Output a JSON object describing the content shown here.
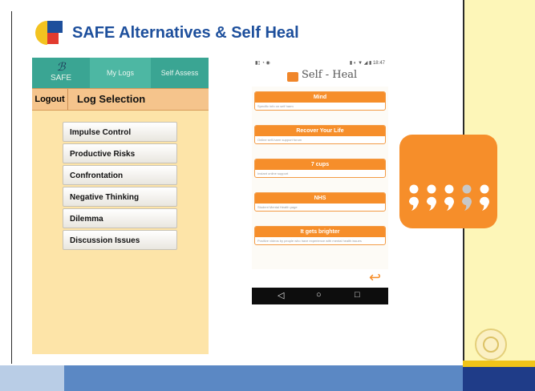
{
  "slide": {
    "title": "SAFE Alternatives & Self Heal"
  },
  "app_safe": {
    "logo_glyph": "ℬ",
    "brand": "SAFE",
    "tabs": [
      "My Logs",
      "Self Assess"
    ],
    "logout_label": "Logout",
    "section_title": "Log Selection",
    "menu_items": [
      "Impulse Control",
      "Productive Risks",
      "Confrontation",
      "Negative Thinking",
      "Dilemma",
      "Discussion Issues"
    ]
  },
  "app_selfheal": {
    "status_left": "▮▯ ◔ ◉",
    "status_right": "▮ ◐ ▼ ◢ ▮ 18:47",
    "title": "Self - Heal",
    "cards": [
      {
        "title": "Mind",
        "subtitle": "Specific info on self harm"
      },
      {
        "title": "Recover Your Life",
        "subtitle": "Online self-harm support forum"
      },
      {
        "title": "7 cups",
        "subtitle": "Instant online support"
      },
      {
        "title": "NHS",
        "subtitle": "Student Mental Health page"
      },
      {
        "title": "It gets brighter",
        "subtitle": "Positive videos by people who have experience with mental health issues"
      }
    ],
    "back_glyph": "↩",
    "nav": [
      "◁",
      "○",
      "□"
    ]
  },
  "colors": {
    "title_blue": "#1d4f9c",
    "orange": "#f68e2a",
    "teal": "#3aa593",
    "panel_yellow": "#fdf6b8"
  }
}
